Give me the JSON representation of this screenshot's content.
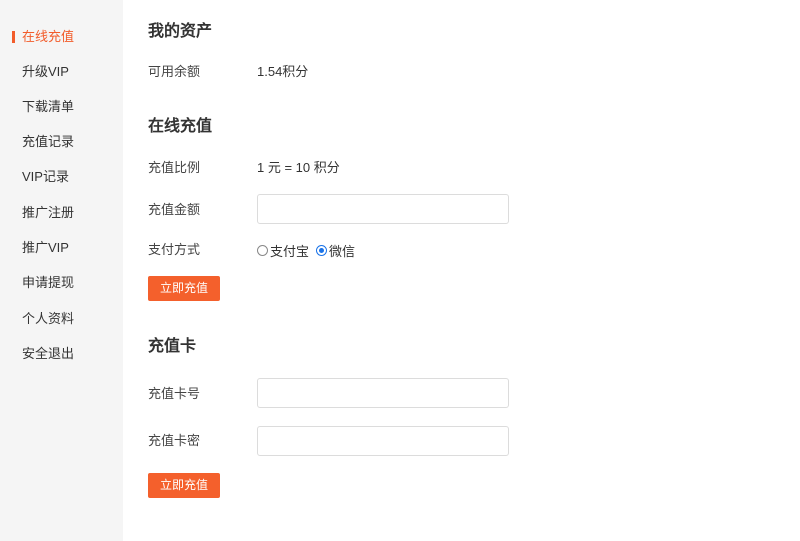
{
  "sidebar": {
    "items": [
      {
        "label": "在线充值",
        "active": true
      },
      {
        "label": "升级VIP"
      },
      {
        "label": "下载清单"
      },
      {
        "label": "充值记录"
      },
      {
        "label": "VIP记录"
      },
      {
        "label": "推广注册"
      },
      {
        "label": "推广VIP"
      },
      {
        "label": "申请提现"
      },
      {
        "label": "个人资料"
      },
      {
        "label": "安全退出"
      }
    ]
  },
  "assets": {
    "title": "我的资产",
    "balance_label": "可用余额",
    "balance_value": "1.54积分"
  },
  "recharge": {
    "title": "在线充值",
    "ratio_label": "充值比例",
    "ratio_value": "1 元 = 10 积分",
    "amount_label": "充值金额",
    "amount_value": "",
    "payment_label": "支付方式",
    "payment_options": [
      {
        "label": "支付宝",
        "checked": false
      },
      {
        "label": "微信",
        "checked": true
      }
    ],
    "submit_label": "立即充值"
  },
  "card": {
    "title": "充值卡",
    "number_label": "充值卡号",
    "number_value": "",
    "password_label": "充值卡密",
    "password_value": "",
    "submit_label": "立即充值"
  },
  "colors": {
    "accent": "#f4602c",
    "sidebar_bg": "#f5f5f5",
    "radio_checked": "#1a73e8"
  }
}
